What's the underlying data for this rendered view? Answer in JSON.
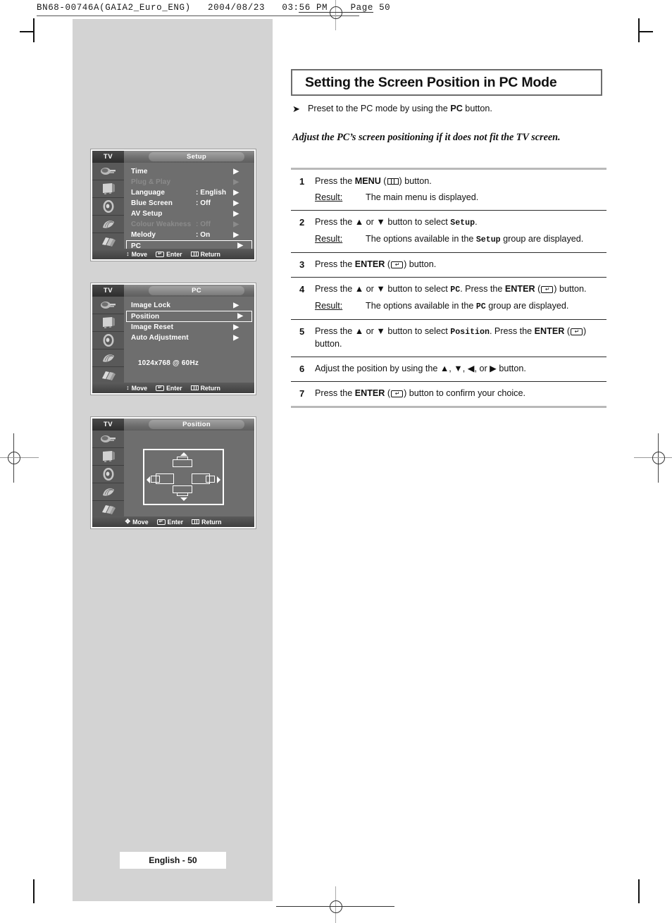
{
  "print_header": "BN68-00746A(GAIA2_Euro_ENG)   2004/08/23   03:56 PM    Page 50",
  "title": "Setting the Screen Position in PC Mode",
  "intro": {
    "arrow": "➤",
    "text_before": "Preset to the PC mode by using the ",
    "bold": "PC",
    "text_after": " button."
  },
  "lead_italic": "Adjust the PC’s screen positioning if it does not fit the TV screen.",
  "steps": [
    {
      "num": "1",
      "parts": [
        {
          "t": "Press the "
        },
        {
          "t": "MENU",
          "b": true
        },
        {
          "t": " ("
        },
        {
          "icon": "menu-key-icon"
        },
        {
          "t": ") button."
        }
      ],
      "result": {
        "label": "Result:",
        "text": "The main menu is displayed."
      }
    },
    {
      "num": "2",
      "parts": [
        {
          "t": "Press the "
        },
        {
          "t": "▲"
        },
        {
          "t": " or "
        },
        {
          "t": "▼"
        },
        {
          "t": " button to select "
        },
        {
          "t": "Setup",
          "m": true
        },
        {
          "t": "."
        }
      ],
      "result": {
        "label": "Result:",
        "parts": [
          {
            "t": "The options available in the "
          },
          {
            "t": "Setup",
            "m": true
          },
          {
            "t": " group are displayed."
          }
        ]
      }
    },
    {
      "num": "3",
      "parts": [
        {
          "t": "Press the "
        },
        {
          "t": "ENTER",
          "b": true
        },
        {
          "t": " ("
        },
        {
          "icon": "enter-key-icon"
        },
        {
          "t": ") button."
        }
      ]
    },
    {
      "num": "4",
      "parts": [
        {
          "t": "Press the "
        },
        {
          "t": "▲"
        },
        {
          "t": " or "
        },
        {
          "t": "▼"
        },
        {
          "t": " button to select "
        },
        {
          "t": "PC",
          "m": true
        },
        {
          "t": ". Press the "
        },
        {
          "t": "ENTER",
          "b": true
        },
        {
          "t": " ("
        },
        {
          "icon": "enter-key-icon"
        },
        {
          "t": ") button."
        }
      ],
      "result": {
        "label": "Result:",
        "parts": [
          {
            "t": "The options available in the "
          },
          {
            "t": "PC",
            "m": true
          },
          {
            "t": " group are displayed."
          }
        ]
      }
    },
    {
      "num": "5",
      "parts": [
        {
          "t": "Press the "
        },
        {
          "t": "▲"
        },
        {
          "t": " or "
        },
        {
          "t": "▼"
        },
        {
          "t": " button to select "
        },
        {
          "t": "Position",
          "m": true
        },
        {
          "t": ". Press the "
        },
        {
          "t": "ENTER",
          "b": true
        },
        {
          "t": " ("
        },
        {
          "icon": "enter-key-icon"
        },
        {
          "t": ") button."
        }
      ]
    },
    {
      "num": "6",
      "parts": [
        {
          "t": "Adjust the position by using the "
        },
        {
          "t": "▲"
        },
        {
          "t": ", "
        },
        {
          "t": "▼"
        },
        {
          "t": ",  "
        },
        {
          "t": "◀"
        },
        {
          "t": ", or "
        },
        {
          "t": "▶"
        },
        {
          "t": " button."
        }
      ]
    },
    {
      "num": "7",
      "parts": [
        {
          "t": "Press the "
        },
        {
          "t": "ENTER",
          "b": true
        },
        {
          "t": " ("
        },
        {
          "icon": "enter-key-icon"
        },
        {
          "t": ") button to confirm your choice."
        }
      ]
    }
  ],
  "osd_footer": {
    "move": "Move",
    "enter": "Enter",
    "return": "Return",
    "move_glyph_updown": "↕",
    "move_glyph_quad": "✥"
  },
  "osd_setup": {
    "tv_label": "TV",
    "tab_label": "Setup",
    "items": [
      {
        "label": "Time",
        "value": "",
        "dim": false,
        "selected": false
      },
      {
        "label": "Plug & Play",
        "value": "",
        "dim": true,
        "selected": false
      },
      {
        "label": "Language",
        "value": ": English",
        "dim": false,
        "selected": false
      },
      {
        "label": "Blue Screen",
        "value": ": Off",
        "dim": false,
        "selected": false
      },
      {
        "label": "AV Setup",
        "value": "",
        "dim": false,
        "selected": false
      },
      {
        "label": "Colour Weakness",
        "value": ": Off",
        "dim": true,
        "selected": false
      },
      {
        "label": "Melody",
        "value": ": On",
        "dim": false,
        "selected": false
      },
      {
        "label": "PC",
        "value": "",
        "dim": false,
        "selected": true
      }
    ]
  },
  "osd_pc": {
    "tv_label": "TV",
    "tab_label": "PC",
    "items": [
      {
        "label": "Image Lock",
        "value": "",
        "dim": false,
        "selected": false
      },
      {
        "label": "Position",
        "value": "",
        "dim": false,
        "selected": true
      },
      {
        "label": "Image Reset",
        "value": "",
        "dim": false,
        "selected": false
      },
      {
        "label": "Auto Adjustment",
        "value": "",
        "dim": false,
        "selected": false
      }
    ],
    "resolution": "1024x768 @ 60Hz"
  },
  "osd_position": {
    "tv_label": "TV",
    "tab_label": "Position"
  },
  "page_footer": "English - 50",
  "colors": {
    "panel_gray": "#d3d3d3",
    "osd_body": "#6e6e6e",
    "osd_iconcol": "#595959",
    "rule_gray": "#b9b9b9"
  }
}
